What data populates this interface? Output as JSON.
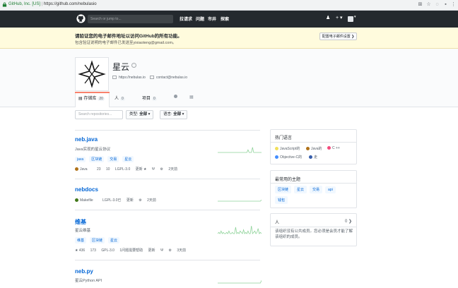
{
  "browser": {
    "org": "GitHub, Inc. [US]",
    "separator": "|",
    "url": "https://github.com/nebulasio"
  },
  "header": {
    "search_placeholder": "Search or jump to...",
    "nav": [
      "拉请求",
      "问题",
      "市井",
      "探索"
    ],
    "plus": "+ ▾"
  },
  "banner": {
    "title": "请验证您的电子邮件地址以访问GitHub的所有功能。",
    "subtitle": "包含验证说明的电子邮件已发送至yixiaoteng@gmail.com。",
    "button": "配置电子邮件设置 ❯"
  },
  "org": {
    "name": "星云",
    "website": "https://nebulas.io",
    "email": "contact@nebulas.io"
  },
  "tabs": [
    {
      "label": "存储库",
      "count": "20"
    },
    {
      "label": "人",
      "count": "0"
    },
    {
      "label": "项目",
      "count": "0"
    },
    {
      "label": "",
      "count": ""
    }
  ],
  "filter": {
    "placeholder": "Search repositories...",
    "type_label": "类型:",
    "type_value": "全部 ▾",
    "lang_label": "语言:",
    "lang_value": "全部 ▾"
  },
  "repos": [
    {
      "name": "neb.java",
      "description": "Java实现的星云协议",
      "topics": [
        "java",
        "区块链",
        "交易",
        "星云"
      ],
      "language": "Java",
      "lang_color": "#b07219",
      "stars": "23",
      "forks": "10",
      "license": "LGPL-3.0",
      "updated": "更新 ★",
      "extra": "2天前",
      "spark": [
        0,
        0,
        0,
        0,
        0,
        0,
        0,
        0,
        0,
        0,
        0,
        0,
        0,
        0,
        0,
        0,
        0,
        0,
        0,
        0,
        0,
        0,
        0,
        0,
        0,
        0,
        0,
        2,
        0,
        0,
        0,
        4,
        0,
        0,
        0,
        0,
        0,
        0,
        0,
        0
      ]
    },
    {
      "name": "nebdocs",
      "description": "",
      "topics": [],
      "language": "Makefile",
      "lang_color": "#427819",
      "license": "LGPL-3.0已",
      "updated": "更新",
      "extra": "2天前",
      "spark": [
        0,
        0,
        0,
        0,
        0,
        0,
        0,
        0,
        0,
        0,
        0,
        0,
        0,
        0,
        0,
        0,
        0,
        0,
        0,
        0,
        0,
        0,
        0,
        0,
        0,
        0,
        0,
        0,
        0,
        0,
        0,
        0,
        0,
        0,
        0,
        0,
        0,
        0,
        0,
        1
      ]
    },
    {
      "name": "维基",
      "description": "星云维基",
      "topics": [
        "维基",
        "区块链",
        "星云"
      ],
      "stars": "★ 436",
      "forks": "173",
      "license": "GPL-3.0",
      "updated": "1问题需要帮助",
      "extra2": "更新",
      "extra": "3天前",
      "spark": [
        0,
        1,
        0,
        2,
        0,
        1,
        0,
        0,
        1,
        0,
        2,
        0,
        0,
        1,
        0,
        0,
        5,
        0,
        1,
        0,
        2,
        1,
        0,
        3,
        0,
        1,
        0,
        2,
        0,
        0,
        6,
        0,
        1,
        2,
        0,
        1,
        4,
        0,
        1,
        0
      ]
    },
    {
      "name": "neb.py",
      "description": "星云Python API",
      "topics": [],
      "spark": [
        0,
        0,
        0,
        0,
        0,
        0,
        0,
        0,
        0,
        0,
        0,
        0,
        0,
        0,
        0,
        0,
        0,
        0,
        0,
        0,
        0,
        0,
        0,
        0,
        0,
        0,
        0,
        0,
        0,
        0,
        0,
        0,
        0,
        0,
        0,
        0,
        0,
        0,
        0,
        2
      ]
    }
  ],
  "side": {
    "languages_title": "热门语言",
    "languages": [
      {
        "name": "JavaScript的",
        "color": "#f1e05a"
      },
      {
        "name": "Java的",
        "color": "#b07219"
      },
      {
        "name": "C ++",
        "color": "#f34b7d"
      },
      {
        "name": "Objective-C的",
        "color": "#438eff"
      },
      {
        "name": "走",
        "color": "#375eab"
      }
    ],
    "topics_title": "最常用的主题",
    "topics": [
      "区块链",
      "星云",
      "交易",
      "api",
      "钱包"
    ],
    "people_title": "人",
    "people_count": "0 ❯",
    "people_text": "该组织没有公共成员。您必须是会员才能了解该组织的成员。"
  }
}
